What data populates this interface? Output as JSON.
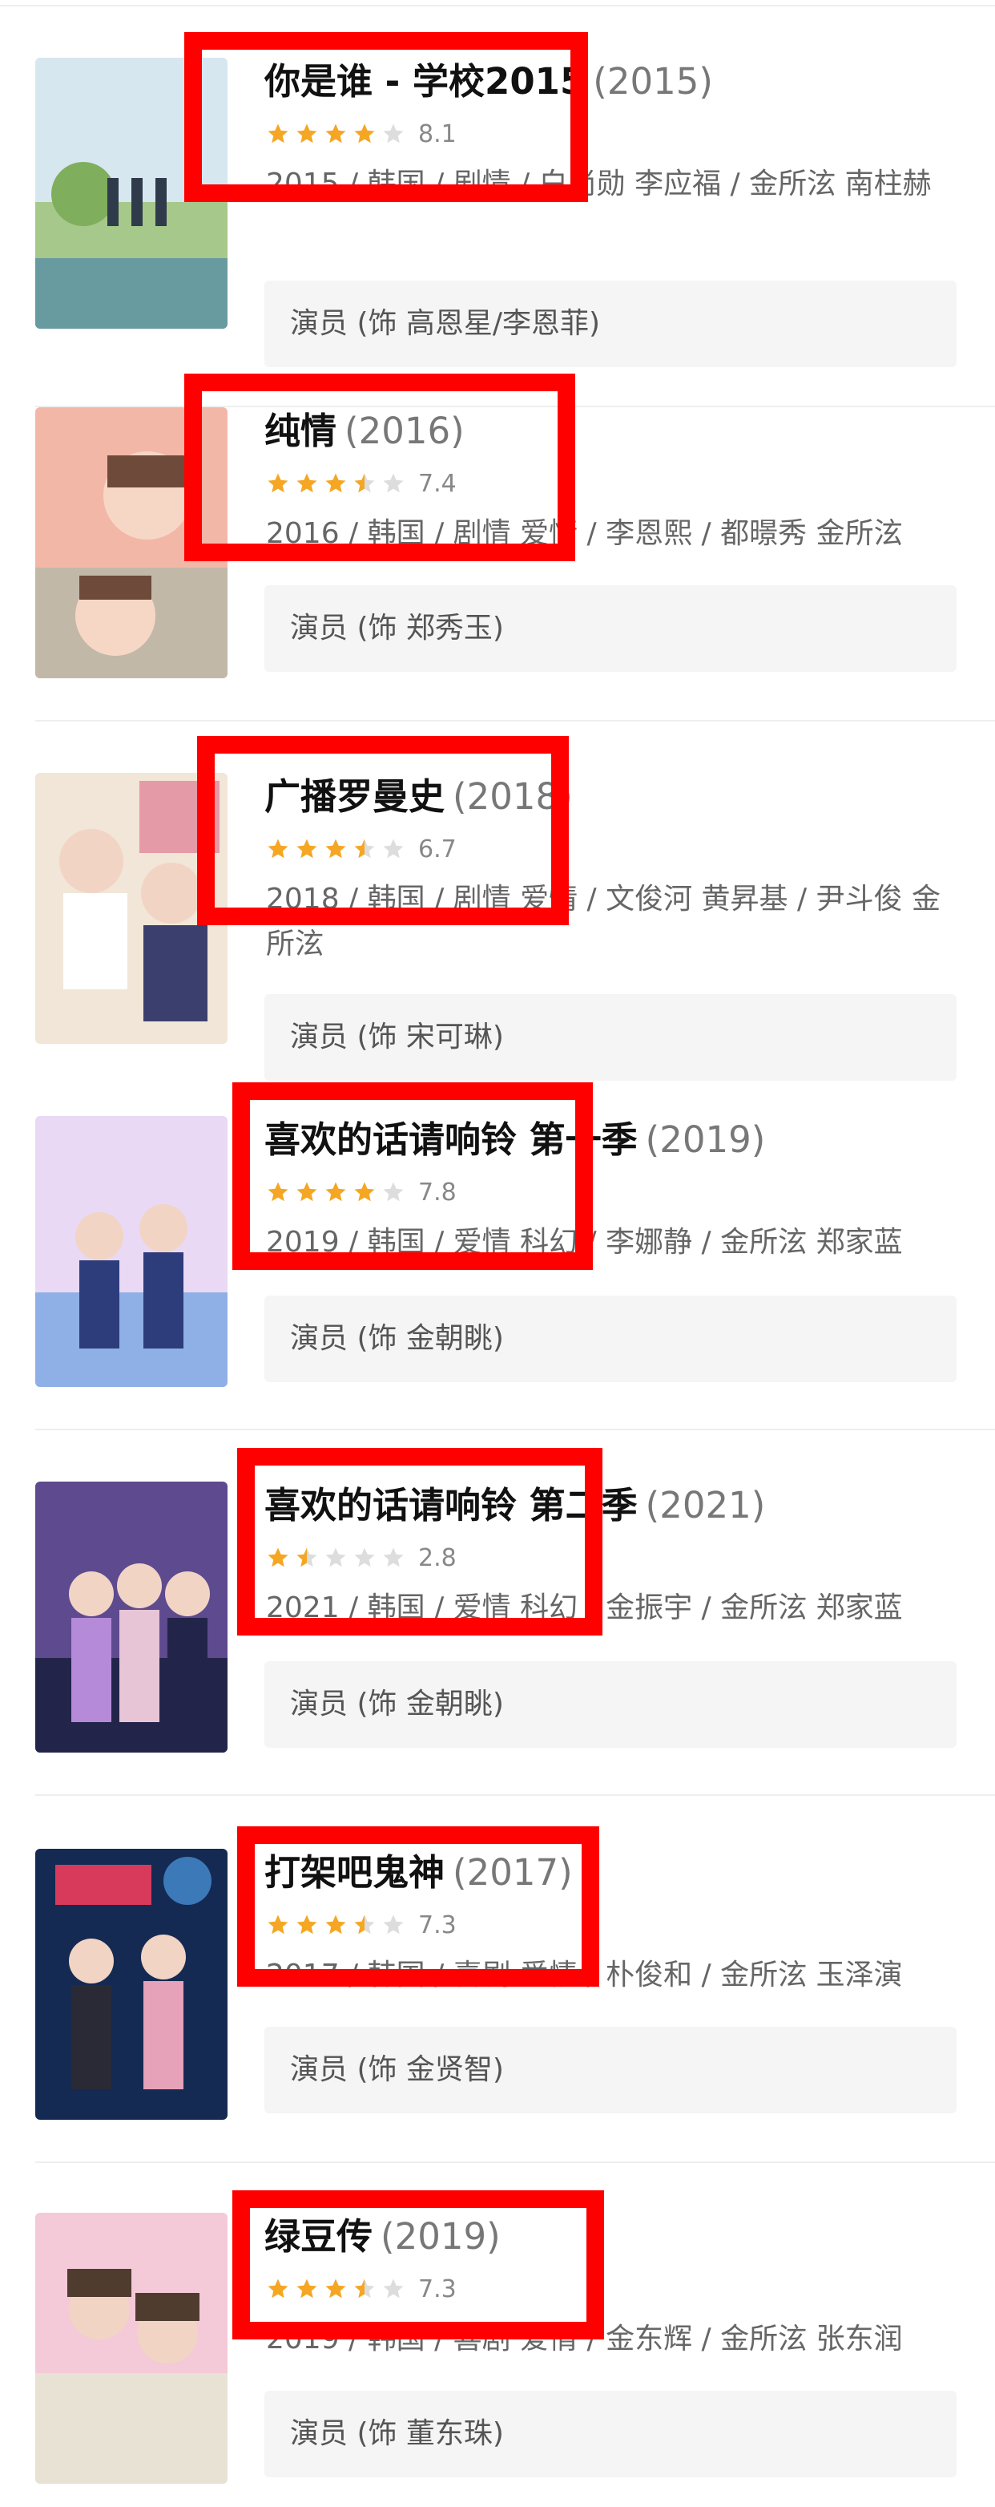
{
  "entries": [
    {
      "title": "你是谁 - 学校2015",
      "year": "(2015)",
      "rating": 4,
      "score": "8.1",
      "meta": "2015 / 韩国 / 剧情 / 白尚勋 李应福 / 金所泫 南柱赫",
      "role": "演员 (饰 高恩星/李恩菲)",
      "poster_colors": [
        "#d7e7f0",
        "#a6c88a",
        "#4e87a8"
      ]
    },
    {
      "title": "纯情",
      "year": "(2016)",
      "rating": 3.5,
      "score": "7.4",
      "meta": "2016 / 韩国 / 剧情 爱情 / 李恩熙 / 都暻秀 金所泫",
      "role": "演员 (饰 郑秀玉)",
      "poster_colors": [
        "#f3b7a8",
        "#c2b8a8",
        "#6d4a3a"
      ]
    },
    {
      "title": "广播罗曼史",
      "year": "(2018)",
      "rating": 3.5,
      "score": "6.7",
      "meta": "2018 / 韩国 / 剧情 爱情 / 文俊河 黄昇基 / 尹斗俊 金所泫",
      "role": "演员 (饰 宋可琳)",
      "poster_colors": [
        "#f1e6d7",
        "#e49aa7",
        "#3a3f6e"
      ]
    },
    {
      "title": "喜欢的话请响铃 第一季",
      "year": "(2019)",
      "rating": 4,
      "score": "7.8",
      "meta": "2019 / 韩国 / 爱情 科幻 / 李娜静 / 金所泫 郑家蓝",
      "role": "演员 (饰 金朝眺)",
      "poster_colors": [
        "#e9d9f4",
        "#8fb0e6",
        "#2d3c7a"
      ]
    },
    {
      "title": "喜欢的话请响铃 第二季",
      "year": "(2021)",
      "rating": 1.5,
      "score": "2.8",
      "meta": "2021 / 韩国 / 爱情 科幻 / 金振宇 / 金所泫 郑家蓝",
      "role": "演员 (饰 金朝眺)",
      "poster_colors": [
        "#5e4a8f",
        "#b58ad8",
        "#23244a"
      ]
    },
    {
      "title": "打架吧鬼神",
      "year": "(2017)",
      "rating": 3.5,
      "score": "7.3",
      "meta": "2017 / 韩国 / 喜剧 爱情 / 朴俊和 / 金所泫 玉泽演",
      "role": "演员 (饰 金贤智)",
      "poster_colors": [
        "#142a52",
        "#3c79b8",
        "#d83a5c"
      ]
    },
    {
      "title": "绿豆传",
      "year": "(2019)",
      "rating": 3.5,
      "score": "7.3",
      "meta": "2019 / 韩国 / 喜剧 爱情 / 金东辉 / 金所泫 张东润",
      "role": "演员 (饰 董东珠)",
      "poster_colors": [
        "#f4c9d8",
        "#e8e2d4",
        "#4f3c2f"
      ]
    }
  ],
  "colors": {
    "star_on": "#f5a623",
    "star_off": "#dddddd",
    "highlight": "#ff0000"
  }
}
